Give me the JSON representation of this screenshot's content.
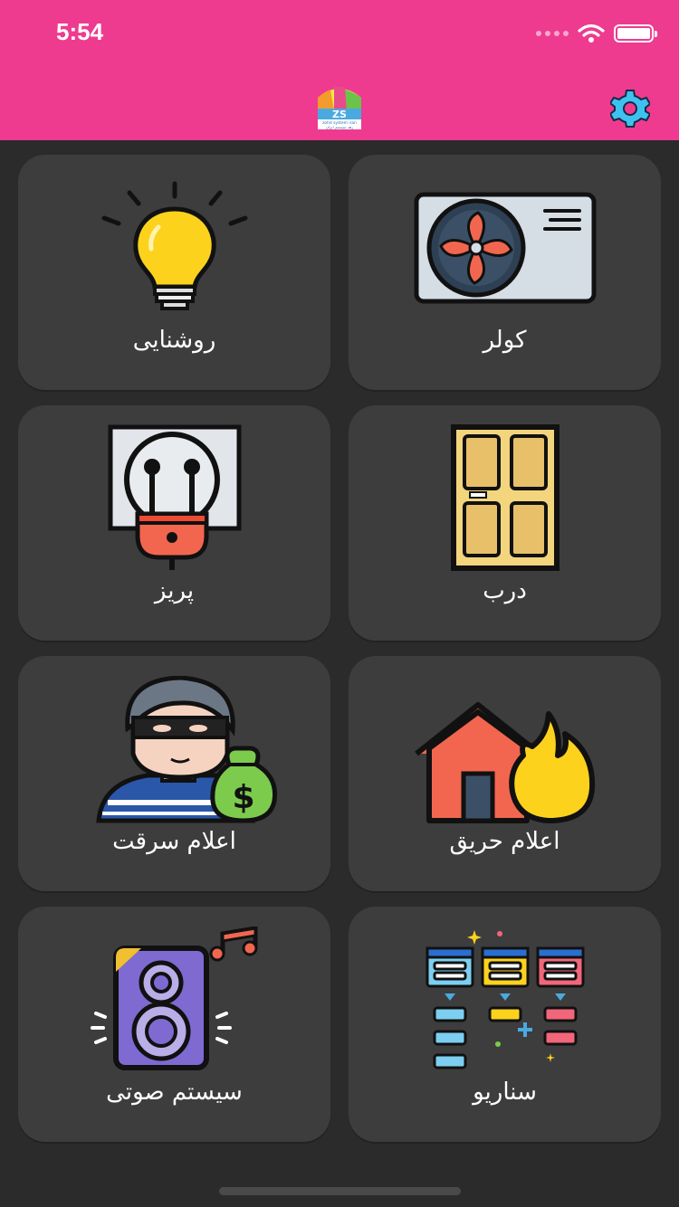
{
  "status_bar": {
    "time": "5:54"
  },
  "header": {
    "logo_text": "zohd system iran",
    "logo_subtext": "زهد سیستم ایران",
    "settings_icon": "gear-icon",
    "accent_color": "#ee3b8f"
  },
  "tiles": [
    {
      "label": "روشنایی",
      "icon": "light-bulb-icon"
    },
    {
      "label": "کولر",
      "icon": "air-conditioner-icon"
    },
    {
      "label": "پریز",
      "icon": "power-socket-icon"
    },
    {
      "label": "درب",
      "icon": "door-icon"
    },
    {
      "label": "اعلام سرقت",
      "icon": "thief-icon"
    },
    {
      "label": "اعلام حریق",
      "icon": "house-fire-icon"
    },
    {
      "label": "سیستم صوتی",
      "icon": "speaker-icon"
    },
    {
      "label": "سناریو",
      "icon": "scenario-flow-icon"
    }
  ]
}
